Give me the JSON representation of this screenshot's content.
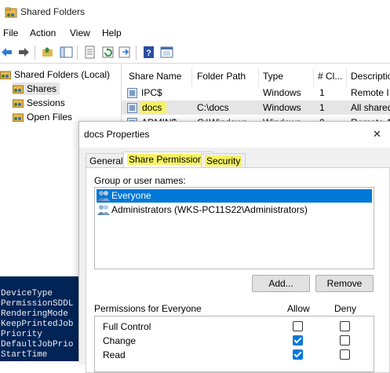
{
  "window": {
    "title": "Shared Folders"
  },
  "menu": [
    "File",
    "Action",
    "View",
    "Help"
  ],
  "toolbar_icons": [
    "back-arrow-icon",
    "forward-arrow-icon",
    "up-folder-icon",
    "show-tree-icon",
    "properties-icon",
    "refresh-icon",
    "export-icon",
    "help-icon",
    "console-icon"
  ],
  "tree": {
    "root": "Shared Folders (Local)",
    "items": [
      "Shares",
      "Sessions",
      "Open Files"
    ]
  },
  "list": {
    "columns": [
      "Share Name",
      "Folder Path",
      "Type",
      "# Cl...",
      "Descriptio"
    ],
    "rows": [
      {
        "name": "IPC$",
        "path": "",
        "type": "Windows",
        "clients": "1",
        "desc": "Remote I"
      },
      {
        "name": "docs",
        "path": "C:\\docs",
        "type": "Windows",
        "clients": "1",
        "desc": "All shared"
      },
      {
        "name": "ADMIN$",
        "path": "C:\\Windows",
        "type": "Windows",
        "clients": "0",
        "desc": "Remote Ad"
      }
    ]
  },
  "powershell": [
    "DeviceType",
    "PermissionSDDL",
    "RenderingMode",
    "KeepPrintedJob",
    "Priority",
    "DefaultJobPrio",
    "StartTime"
  ],
  "dialog": {
    "title": "docs Properties",
    "tabs": [
      "General",
      "Share Permissions",
      "Security"
    ],
    "group_label": "Group or user names:",
    "users": [
      "Everyone",
      "Administrators (WKS-PC11S22\\Administrators)"
    ],
    "add_label": "Add...",
    "remove_label": "Remove",
    "perm_header": "Permissions for Everyone",
    "allow_label": "Allow",
    "deny_label": "Deny",
    "permissions": [
      {
        "name": "Full Control",
        "allow": false,
        "deny": false
      },
      {
        "name": "Change",
        "allow": true,
        "deny": false
      },
      {
        "name": "Read",
        "allow": true,
        "deny": false
      }
    ],
    "close_glyph": "✕"
  },
  "colors": {
    "accent": "#0078d7",
    "highlight": "#f7f264",
    "powershell_bg": "#012456"
  }
}
